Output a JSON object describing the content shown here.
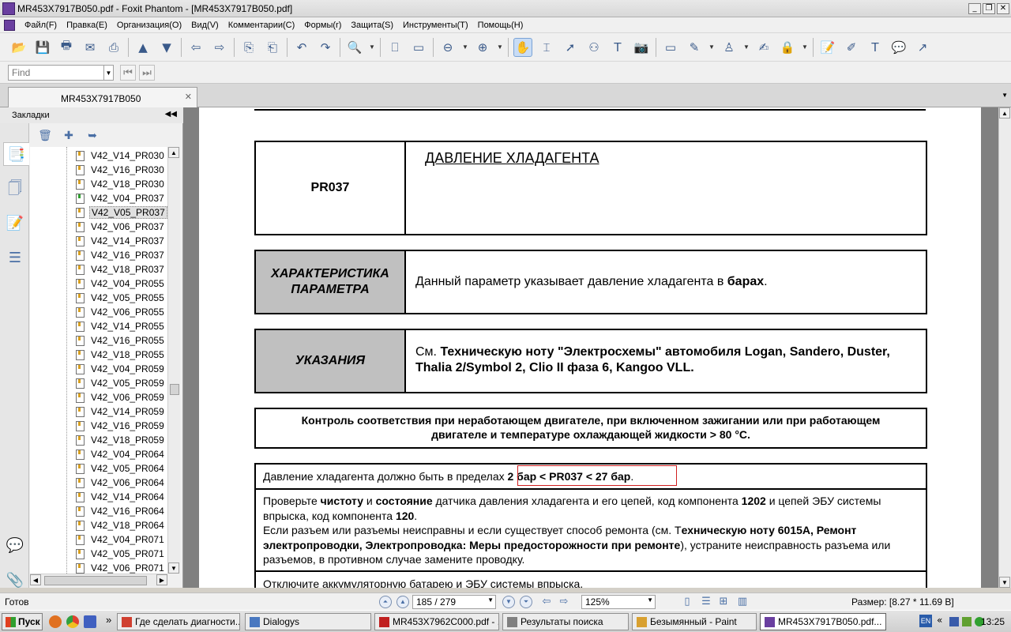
{
  "window": {
    "title": "MR453X7917B050.pdf - Foxit Phantom - [MR453X7917B050.pdf]",
    "minimize": "_",
    "restore": "❐",
    "close": "✕"
  },
  "menu": [
    "Файл(F)",
    "Правка(E)",
    "Организация(O)",
    "Вид(V)",
    "Комментарии(C)",
    "Формы(r)",
    "Защита(S)",
    "Инструменты(T)",
    "Помощь(H)"
  ],
  "find": {
    "placeholder": "Find",
    "dropdown": "▼",
    "prev": "⏮",
    "next": "⏭"
  },
  "tab": {
    "label": "MR453X7917B050",
    "close": "✕",
    "menu": "▼"
  },
  "bookmarks": {
    "header": "Закладки",
    "collapse": "◀◀",
    "items": [
      {
        "label": "V42_V14_PR030",
        "icon": "bookmark-page-icon"
      },
      {
        "label": "V42_V16_PR030",
        "icon": "bookmark-page-icon"
      },
      {
        "label": "V42_V18_PR030",
        "icon": "bookmark-page-icon"
      },
      {
        "label": "V42_V04_PR037",
        "icon": "bookmark-page-green-icon"
      },
      {
        "label": "V42_V05_PR037",
        "icon": "bookmark-page-icon",
        "selected": true
      },
      {
        "label": "V42_V06_PR037",
        "icon": "bookmark-page-icon"
      },
      {
        "label": "V42_V14_PR037",
        "icon": "bookmark-page-icon"
      },
      {
        "label": "V42_V16_PR037",
        "icon": "bookmark-page-icon"
      },
      {
        "label": "V42_V18_PR037",
        "icon": "bookmark-page-icon"
      },
      {
        "label": "V42_V04_PR055",
        "icon": "bookmark-page-icon"
      },
      {
        "label": "V42_V05_PR055",
        "icon": "bookmark-page-icon"
      },
      {
        "label": "V42_V06_PR055",
        "icon": "bookmark-page-icon"
      },
      {
        "label": "V42_V14_PR055",
        "icon": "bookmark-page-icon"
      },
      {
        "label": "V42_V16_PR055",
        "icon": "bookmark-page-icon"
      },
      {
        "label": "V42_V18_PR055",
        "icon": "bookmark-page-icon"
      },
      {
        "label": "V42_V04_PR059",
        "icon": "bookmark-page-icon"
      },
      {
        "label": "V42_V05_PR059",
        "icon": "bookmark-page-icon"
      },
      {
        "label": "V42_V06_PR059",
        "icon": "bookmark-page-icon"
      },
      {
        "label": "V42_V14_PR059",
        "icon": "bookmark-page-icon"
      },
      {
        "label": "V42_V16_PR059",
        "icon": "bookmark-page-icon"
      },
      {
        "label": "V42_V18_PR059",
        "icon": "bookmark-page-icon"
      },
      {
        "label": "V42_V04_PR064",
        "icon": "bookmark-page-icon"
      },
      {
        "label": "V42_V05_PR064",
        "icon": "bookmark-page-icon"
      },
      {
        "label": "V42_V06_PR064",
        "icon": "bookmark-page-icon"
      },
      {
        "label": "V42_V14_PR064",
        "icon": "bookmark-page-icon"
      },
      {
        "label": "V42_V16_PR064",
        "icon": "bookmark-page-icon"
      },
      {
        "label": "V42_V18_PR064",
        "icon": "bookmark-page-icon"
      },
      {
        "label": "V42_V04_PR071",
        "icon": "bookmark-page-icon"
      },
      {
        "label": "V42_V05_PR071",
        "icon": "bookmark-page-icon"
      },
      {
        "label": "V42_V06_PR071",
        "icon": "bookmark-page-icon"
      }
    ]
  },
  "document": {
    "param_code": "PR037",
    "param_title": "ДАВЛЕНИЕ ХЛАДАГЕНТА",
    "char_label_1": "ХАРАКТЕРИСТИКА",
    "char_label_2": "ПАРАМЕТРА",
    "char_text": "Данный параметр указывает давление хладагента в ",
    "char_bold": "барах",
    "char_end": ".",
    "notes_label": "УКАЗАНИЯ",
    "notes_prefix": "См. ",
    "notes_bold": "Техническую ноту \"Электросхемы\" автомобиля Logan, Sandero, Duster, Thalia 2/Symbol 2, Clio II фаза 6, Kangoo VLL.",
    "control_line1": "Контроль соответствия при неработающем двигателе, при включенном зажигании или при работающем",
    "control_line2": "двигателе и температуре охлаждающей жидкости > 80 °C.",
    "range_prefix": "Давление хладагента должно быть в пределах ",
    "range_bold": "2 бар < PR037 < 27 бар",
    "range_end": ".",
    "check_1": "Проверьте ",
    "check_2": "чистоту",
    "check_3": " и ",
    "check_4": "состояние",
    "check_5": " датчика давления хладагента и его цепей, код компонента ",
    "check_6": "1202",
    "check_7": " и цепей ЭБУ системы впрыска, код компонента ",
    "check_8": "120",
    "check_9": ".",
    "repair_1": "Если разъем или разъемы неисправны и если существует способ ремонта (см. Т",
    "repair_2": "ехническую ноту 6015A, Ремонт электропроводки, Электропроводка: Меры предосторожности при ремонте",
    "repair_3": "), устраните неисправность разъема или разъемов, в противном случае замените проводку.",
    "disconnect": "Отключите аккумуляторную батарею и ЭБУ системы впрыска."
  },
  "status": {
    "ready": "Готов",
    "page": "185 / 279",
    "zoom": "125%",
    "size": "Размер: [8.27 * 11.69 В]"
  },
  "taskbar": {
    "start": "Пуск",
    "more": "»",
    "tasks": [
      {
        "label": "Где сделать диагности...",
        "color": "#d04030"
      },
      {
        "label": "Dialogys",
        "color": "#4a78c0"
      },
      {
        "label": "MR453X7962C000.pdf - ...",
        "color": "#c02020"
      },
      {
        "label": "Результаты поиска",
        "color": "#808080"
      },
      {
        "label": "Безымянный - Paint",
        "color": "#d8a030"
      },
      {
        "label": "MR453X7917B050.pdf...",
        "color": "#6a3fa0",
        "active": true
      }
    ],
    "lang": "EN",
    "tray_chevron": "«",
    "clock": "13:25"
  },
  "colors": {
    "accent": "#4a6fa5",
    "highlight_box": "#d02020",
    "grey_cell": "#c0c0c0"
  }
}
